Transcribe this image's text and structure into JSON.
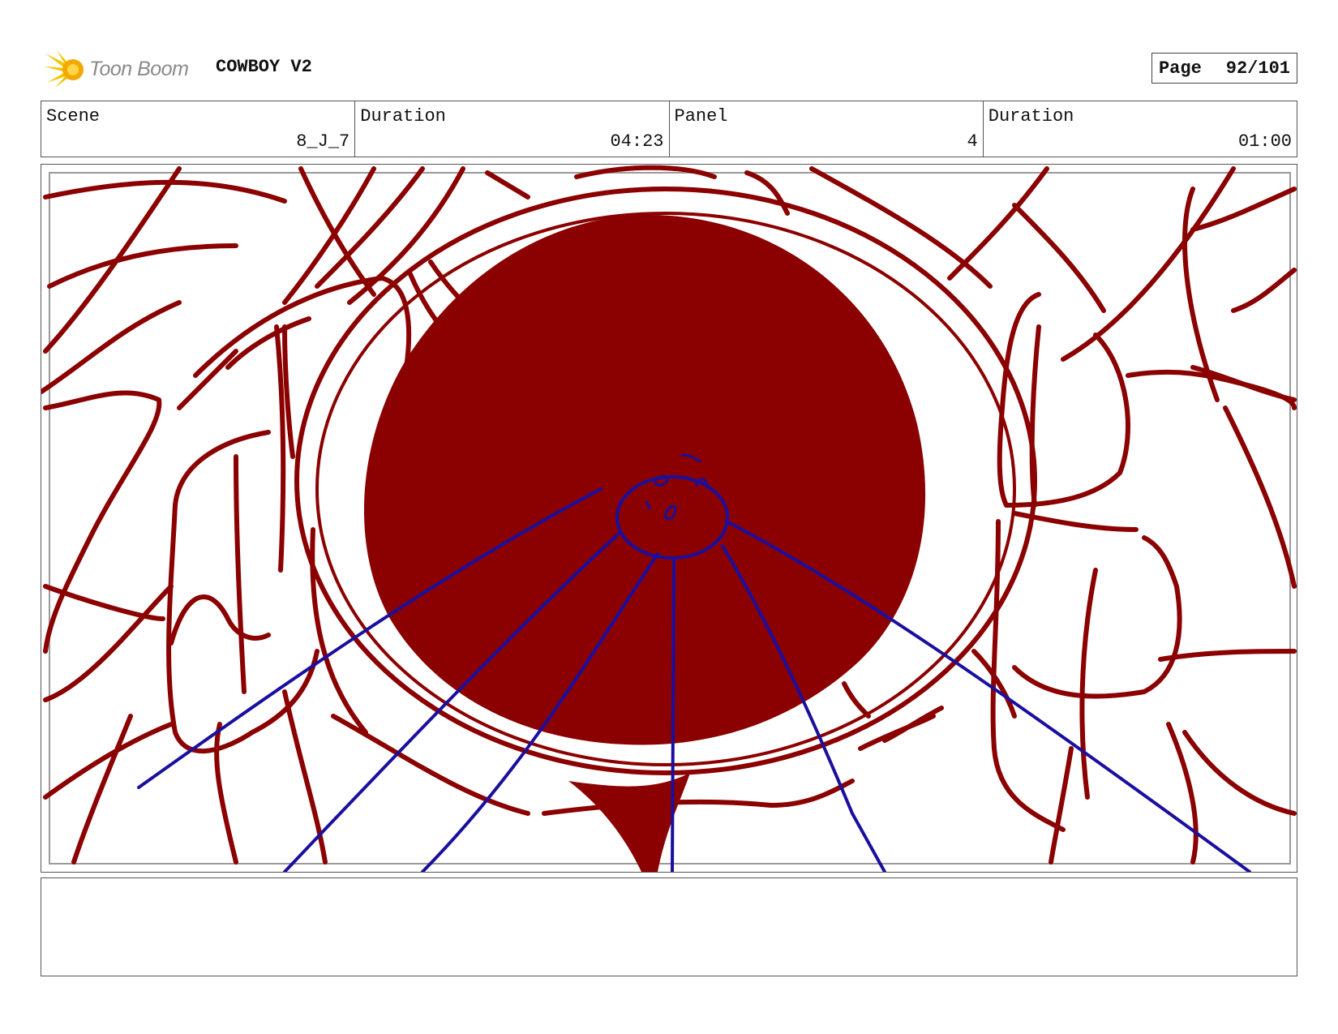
{
  "brand": {
    "name": "Toon Boom",
    "logo_icon": "starburst-logo-icon"
  },
  "project": {
    "title": "COWBOY V2"
  },
  "page": {
    "label": "Page",
    "value": "92/101"
  },
  "info": [
    {
      "label": "Scene",
      "value": "8_J_7"
    },
    {
      "label": "Duration",
      "value": "04:23"
    },
    {
      "label": "Panel",
      "value": "4"
    },
    {
      "label": "Duration",
      "value": "01:00"
    }
  ],
  "panel_image": {
    "description_icon": "storyboard-sketch-image",
    "sketch_color": "#8b0000",
    "overlay_color": "#1a0f9e"
  },
  "notes": {
    "text": ""
  }
}
